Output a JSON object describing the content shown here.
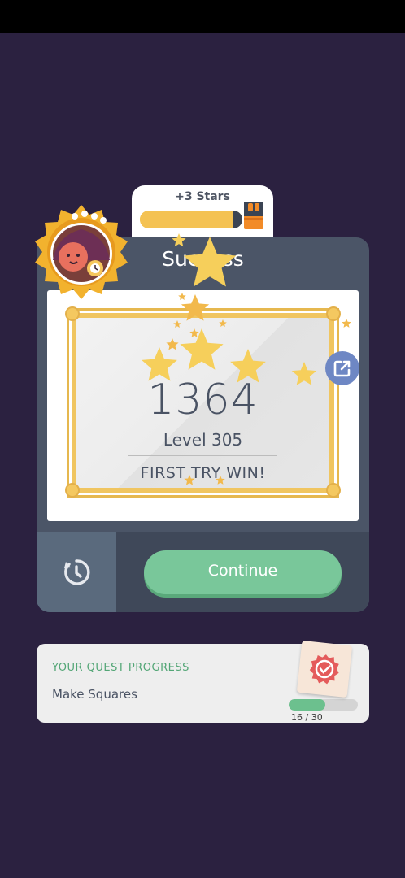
{
  "reward": {
    "label": "+3 Stars",
    "progress": 0.95
  },
  "card": {
    "title": "Success",
    "score": "1364",
    "level": "Level 305",
    "result": "FIRST TRY WIN!",
    "continue_label": "Continue"
  },
  "quest": {
    "heading": "YOUR QUEST PROGRESS",
    "name": "Make Squares",
    "count": "16 / 30",
    "progress": 0.53
  },
  "icons": {
    "share": "share-icon",
    "replay": "replay-icon",
    "chest": "chest-icon",
    "avatar": "avatar-badge",
    "quest_badge": "quest-badge-icon"
  },
  "colors": {
    "background": "#2b2140",
    "card": "#4b5567",
    "gold": "#f0c560",
    "continue": "#79c79a",
    "quest_accent": "#53a676",
    "share": "#6e87c4"
  }
}
